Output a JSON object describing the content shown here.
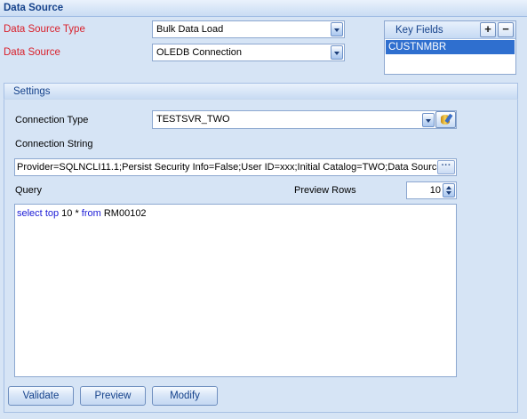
{
  "header": {
    "title": "Data Source"
  },
  "form": {
    "data_source_type_label": "Data Source Type",
    "data_source_type_value": "Bulk Data Load",
    "data_source_label": "Data Source",
    "data_source_value": "OLEDB Connection"
  },
  "key_fields": {
    "title": "Key Fields",
    "add_label": "+",
    "remove_label": "−",
    "items": [
      "CUSTNMBR"
    ]
  },
  "settings": {
    "title": "Settings",
    "connection_type_label": "Connection Type",
    "connection_type_value": "TESTSVR_TWO",
    "connection_string_label": "Connection String",
    "connection_string_value": "Provider=SQLNCLI11.1;Persist Security Info=False;User ID=xxx;Initial Catalog=TWO;Data Source",
    "ellipsis_label": "···",
    "query_label": "Query",
    "preview_rows_label": "Preview Rows",
    "preview_rows_value": "10",
    "query": {
      "kw1": "select",
      "kw2": "top",
      "t1": " 10 * ",
      "kw3": "from",
      "t2": " RM00102"
    }
  },
  "buttons": {
    "validate": "Validate",
    "preview": "Preview",
    "modify": "Modify"
  },
  "colors": {
    "background": "#d6e4f5",
    "required_label": "#d9202b",
    "header_text": "#15428b",
    "selection": "#2f6fcf",
    "sql_keyword": "#1a1ad6"
  }
}
